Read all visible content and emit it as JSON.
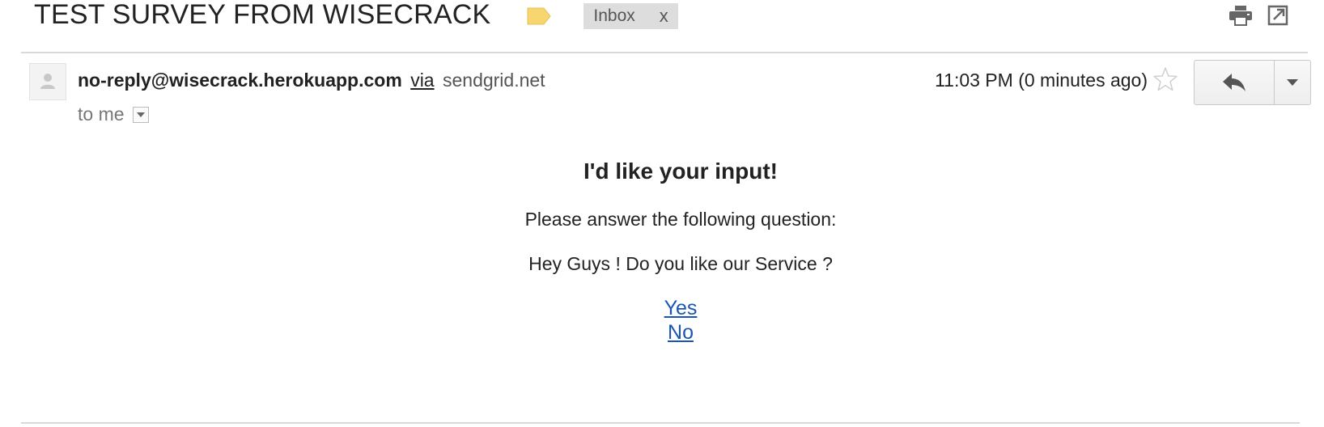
{
  "subject": {
    "title": "TEST SURVEY FROM WISECRACK",
    "importance_marker": "label-tag-icon",
    "label_chip": {
      "text": "Inbox",
      "remove": "x"
    }
  },
  "toolbar": {
    "icons": [
      "print-icon",
      "open-in-new-window-icon"
    ]
  },
  "message": {
    "sender_email": "no-reply@wisecrack.herokuapp.com",
    "via_label": "via",
    "via_domain": "sendgrid.net",
    "recipient": "to me",
    "timestamp": "11:03 PM (0 minutes ago)",
    "star_icon": "star-icon",
    "reply_icon": "reply-icon",
    "more_icon": "dropdown-arrow-icon"
  },
  "body": {
    "heading": "I'd like your input!",
    "prompt": "Please answer the following question:",
    "question": "Hey Guys ! Do you like our Service ?",
    "answers": [
      "Yes",
      "No"
    ]
  },
  "colors": {
    "link": "#1a55b5",
    "marker": "#f7d56f",
    "chip_bg": "#dddddd",
    "divider": "#d9d9d9"
  }
}
